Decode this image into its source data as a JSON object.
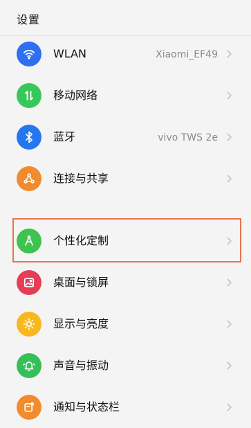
{
  "header": {
    "title": "设置"
  },
  "items": [
    {
      "label": "WLAN",
      "value": "Xiaomi_EF49",
      "icon": "wifi-icon",
      "color": "#2e6ef0"
    },
    {
      "label": "移动网络",
      "value": "",
      "icon": "mobile-data-icon",
      "color": "#38c75a"
    },
    {
      "label": "蓝牙",
      "value": "vivo TWS 2e",
      "icon": "bluetooth-icon",
      "color": "#2577ee"
    },
    {
      "label": "连接与共享",
      "value": "",
      "icon": "share-icon",
      "color": "#f28a2e"
    },
    {
      "label": "个性化定制",
      "value": "",
      "icon": "customize-icon",
      "color": "#3fc24f"
    },
    {
      "label": "桌面与锁屏",
      "value": "",
      "icon": "wallpaper-icon",
      "color": "#e63d57"
    },
    {
      "label": "显示与亮度",
      "value": "",
      "icon": "brightness-icon",
      "color": "#f7b81f"
    },
    {
      "label": "声音与振动",
      "value": "",
      "icon": "bell-icon",
      "color": "#34bf58"
    },
    {
      "label": "通知与状态栏",
      "value": "",
      "icon": "notification-icon",
      "color": "#f28a2e"
    }
  ],
  "highlight": {
    "color": "#e8744c",
    "target": "个性化定制"
  }
}
